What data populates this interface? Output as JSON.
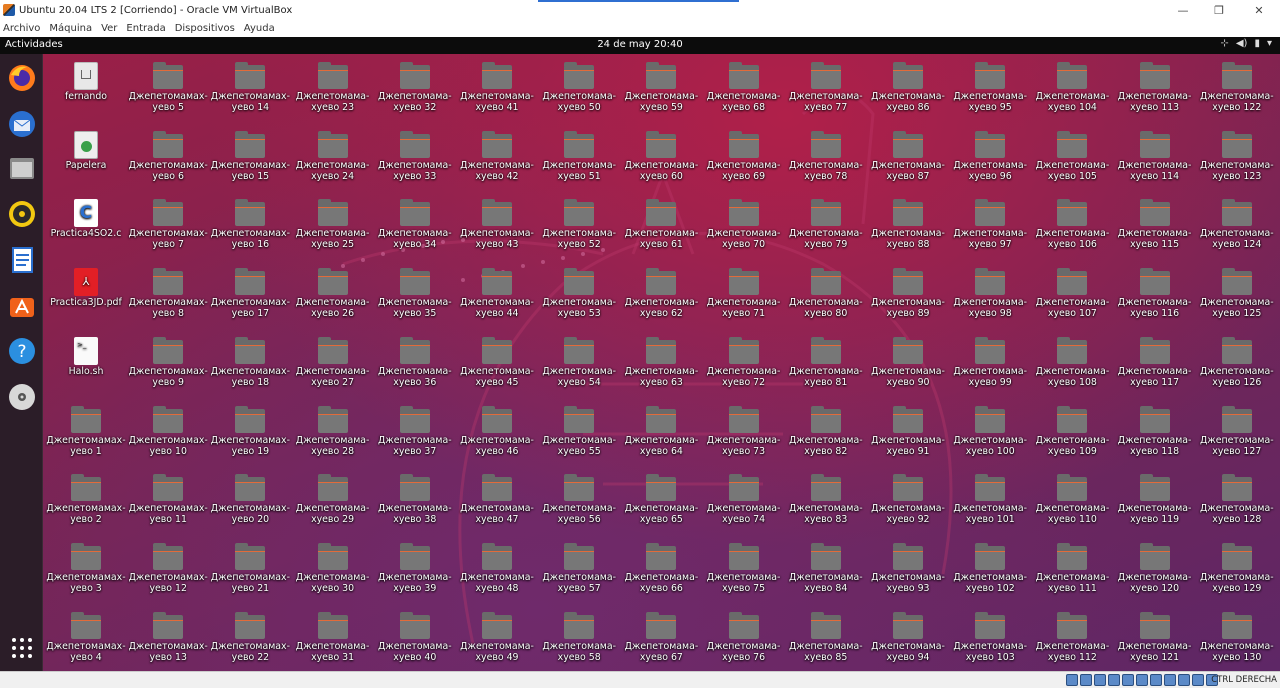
{
  "window": {
    "title": "Ubuntu 20.04 LTS 2 [Corriendo] - Oracle VM VirtualBox",
    "minimize_icon": "minimize-icon",
    "maximize_icon": "maximize-icon",
    "close_icon": "close-icon"
  },
  "menu": [
    "Archivo",
    "Máquina",
    "Ver",
    "Entrada",
    "Dispositivos",
    "Ayuda"
  ],
  "topbar": {
    "activities": "Actividades",
    "clock": "24 de may  20:40",
    "tray_icons": [
      "network-icon",
      "volume-icon",
      "battery-icon",
      "system-menu-icon"
    ]
  },
  "dock": [
    "firefox",
    "thunderbird",
    "files",
    "rhythmbox",
    "libreoffice-writer",
    "ubuntu-software",
    "help",
    "optical-disc",
    "show-applications"
  ],
  "special_icons": [
    {
      "label": "fernando",
      "type": "home"
    },
    {
      "label": "Papelera",
      "type": "trash"
    },
    {
      "label": "Practica4SO2.c",
      "type": "c"
    },
    {
      "label": "Practica3JD.pdf",
      "type": "pdf"
    },
    {
      "label": "Halo.sh",
      "type": "sh"
    }
  ],
  "first_column_folders": [
    "Джепетомамах-уево 1",
    "Джепетомамах-уево 2",
    "Джепетомамах-уево 3",
    "Джепетомамах-уево 4"
  ],
  "folder_columns": [
    [
      "Джепетомамах-уево 5",
      "Джепетомамах-уево 6",
      "Джепетомамах-уево 7",
      "Джепетомамах-уево 8",
      "Джепетомамах-уево 9",
      "Джепетомамах-уево 10",
      "Джепетомамах-уево 11",
      "Джепетомамах-уево 12",
      "Джепетомамах-уево 13"
    ],
    [
      "Джепетомамах-уево 14",
      "Джепетомамах-уево 15",
      "Джепетомамах-уево 16",
      "Джепетомамах-уево 17",
      "Джепетомамах-уево 18",
      "Джепетомамах-уево 19",
      "Джепетомамах-уево 20",
      "Джепетомамах-уево 21",
      "Джепетомамах-уево 22"
    ],
    [
      "Джепетомама-хуево 23",
      "Джепетомама-хуево 24",
      "Джепетомама-хуево 25",
      "Джепетомама-хуево 26",
      "Джепетомама-хуево 27",
      "Джепетомама-хуево 28",
      "Джепетомама-хуево 29",
      "Джепетомама-хуево 30",
      "Джепетомама-хуево 31"
    ],
    [
      "Джепетомама-хуево 32",
      "Джепетомама-хуево 33",
      "Джепетомама-хуево 34",
      "Джепетомама-хуево 35",
      "Джепетомама-хуево 36",
      "Джепетомама-хуево 37",
      "Джепетомама-хуево 38",
      "Джепетомама-хуево 39",
      "Джепетомама-хуево 40"
    ],
    [
      "Джепетомама-хуево 41",
      "Джепетомама-хуево 42",
      "Джепетомама-хуево 43",
      "Джепетомама-хуево 44",
      "Джепетомама-хуево 45",
      "Джепетомама-хуево 46",
      "Джепетомама-хуево 47",
      "Джепетомама-хуево 48",
      "Джепетомама-хуево 49"
    ],
    [
      "Джепетомама-хуево 50",
      "Джепетомама-хуево 51",
      "Джепетомама-хуево 52",
      "Джепетомама-хуево 53",
      "Джепетомама-хуево 54",
      "Джепетомама-хуево 55",
      "Джепетомама-хуево 56",
      "Джепетомама-хуево 57",
      "Джепетомама-хуево 58"
    ],
    [
      "Джепетомама-хуево 59",
      "Джепетомама-хуево 60",
      "Джепетомама-хуево 61",
      "Джепетомама-хуево 62",
      "Джепетомама-хуево 63",
      "Джепетомама-хуево 64",
      "Джепетомама-хуево 65",
      "Джепетомама-хуево 66",
      "Джепетомама-хуево 67"
    ],
    [
      "Джепетомама-хуево 68",
      "Джепетомама-хуево 69",
      "Джепетомама-хуево 70",
      "Джепетомама-хуево 71",
      "Джепетомама-хуево 72",
      "Джепетомама-хуево 73",
      "Джепетомама-хуево 74",
      "Джепетомама-хуево 75",
      "Джепетомама-хуево 76"
    ],
    [
      "Джепетомама-хуево 77",
      "Джепетомама-хуево 78",
      "Джепетомама-хуево 79",
      "Джепетомама-хуево 80",
      "Джепетомама-хуево 81",
      "Джепетомама-хуево 82",
      "Джепетомама-хуево 83",
      "Джепетомама-хуево 84",
      "Джепетомама-хуево 85"
    ],
    [
      "Джепетомама-хуево 86",
      "Джепетомама-хуево 87",
      "Джепетомама-хуево 88",
      "Джепетомама-хуево 89",
      "Джепетомама-хуево 90",
      "Джепетомама-хуево 91",
      "Джепетомама-хуево 92",
      "Джепетомама-хуево 93",
      "Джепетомама-хуево 94"
    ],
    [
      "Джепетомама-хуево 95",
      "Джепетомама-хуево 96",
      "Джепетомама-хуево 97",
      "Джепетомама-хуево 98",
      "Джепетомама-хуево 99",
      "Джепетомама-хуево 100",
      "Джепетомама-хуево 101",
      "Джепетомама-хуево 102",
      "Джепетомама-хуево 103"
    ],
    [
      "Джепетомама-хуево 104",
      "Джепетомама-хуево 105",
      "Джепетомама-хуево 106",
      "Джепетомама-хуево 107",
      "Джепетомама-хуево 108",
      "Джепетомама-хуево 109",
      "Джепетомама-хуево 110",
      "Джепетомама-хуево 111",
      "Джепетомама-хуево 112"
    ],
    [
      "Джепетомама-хуево 113",
      "Джепетомама-хуево 114",
      "Джепетомама-хуево 115",
      "Джепетомама-хуево 116",
      "Джепетомама-хуево 117",
      "Джепетомама-хуево 118",
      "Джепетомама-хуево 119",
      "Джепетомама-хуево 120",
      "Джепетомама-хуево 121"
    ],
    [
      "Джепетомама-хуево 122",
      "Джепетомама-хуево 123",
      "Джепетомама-хуево 124",
      "Джепетомама-хуево 125",
      "Джепетомама-хуево 126",
      "Джепетомама-хуево 127",
      "Джепетомама-хуево 128",
      "Джепетомама-хуево 129",
      "Джепетомама-хуево 130"
    ]
  ],
  "statusbar": {
    "host_key": "CTRL DERECHA"
  }
}
